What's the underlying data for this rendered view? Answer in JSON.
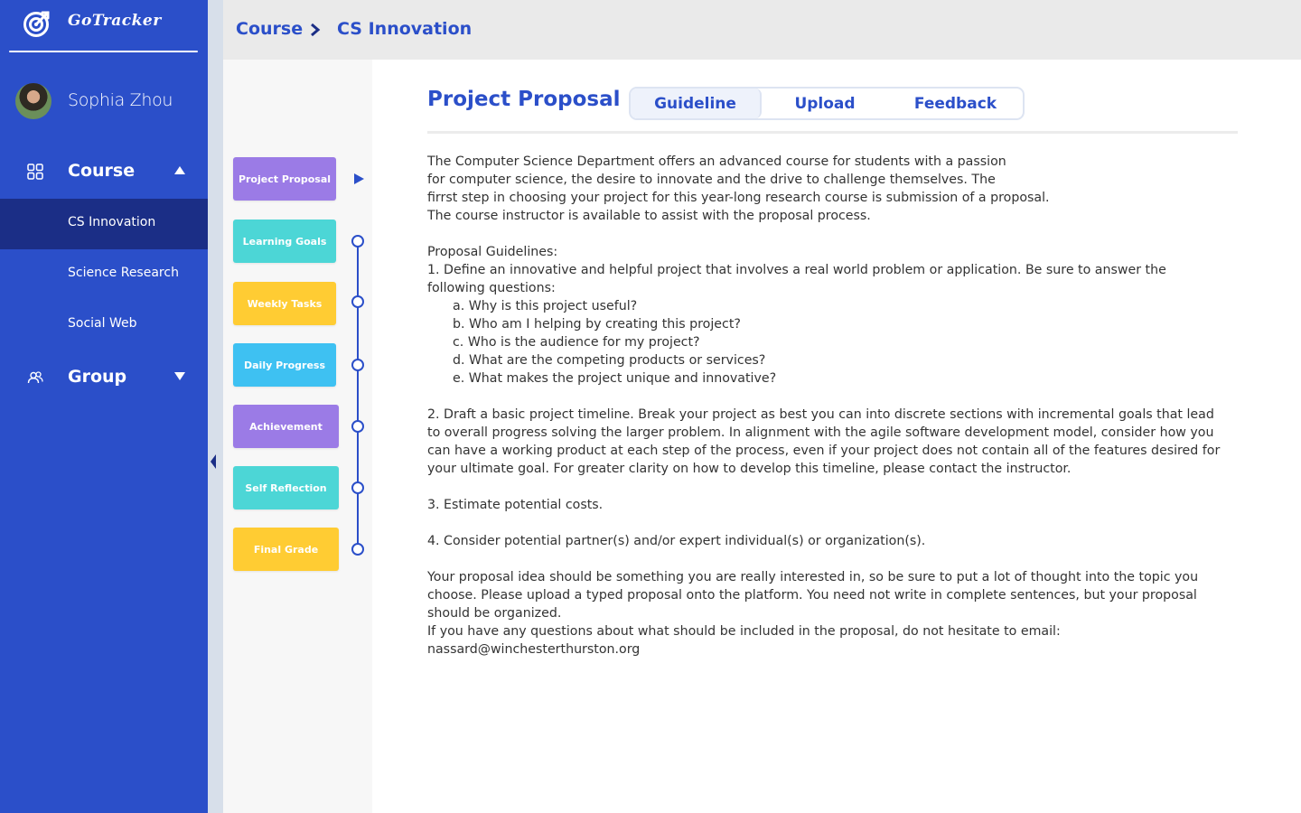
{
  "app": {
    "name": "GoTracker",
    "colors": {
      "sidebar": "#2b4fc9",
      "sidebar_active": "#1b2e86",
      "accent": "#2b4fc9",
      "header_bg": "#eaeaea",
      "purple": "#9b7be6",
      "teal": "#4cd6d6",
      "yellow": "#ffcc33",
      "sky": "#3ec1f2"
    }
  },
  "user": {
    "name": "Sophia Zhou"
  },
  "sidebar": {
    "course_label": "Course",
    "course_items": [
      "CS Innovation",
      "Science Research",
      "Social Web"
    ],
    "active_item": "CS Innovation",
    "group_label": "Group"
  },
  "breadcrumb": {
    "level1": "Course",
    "level2": "CS Innovation"
  },
  "steps": [
    {
      "label": "Project Proposal",
      "color": "#9b7be6"
    },
    {
      "label": "Learning Goals",
      "color": "#4cd6d6"
    },
    {
      "label": "Weekly Tasks",
      "color": "#ffcc33"
    },
    {
      "label": "Daily Progress",
      "color": "#3ec1f2"
    },
    {
      "label": "Achievement",
      "color": "#9b7be6"
    },
    {
      "label": "Self Reflection",
      "color": "#4cd6d6"
    },
    {
      "label": "Final Grade",
      "color": "#ffcc33"
    }
  ],
  "main": {
    "title": "Project Proposal",
    "tabs": [
      "Guideline",
      "Upload",
      "Feedback"
    ],
    "active_tab": "Guideline",
    "content": {
      "intro": [
        "The Computer Science Department offers an advanced course for students with a passion",
        "for computer science, the desire to innovate and the drive to challenge themselves. The",
        "firrst step in choosing your project for this year-long research course is submission of a proposal.",
        "The course instructor is available to assist with the proposal process."
      ],
      "guidelines_heading": "Proposal Guidelines:",
      "item1": [
        "1. Define an innovative and helpful project that involves a real world problem or application. Be sure to answer the",
        "following questions:"
      ],
      "item1_questions": [
        "a. Why is this project useful?",
        "b. Who am I helping by creating this project?",
        "c. Who is the audience for my project?",
        "d. What are the competing products or services?",
        "e. What makes the project unique and innovative?"
      ],
      "item2": [
        "2. Draft a basic project timeline. Break your project as best you can into discrete sections with incremental goals that lead",
        "to overall progress solving the larger problem. In alignment with the agile software development model, consider how you",
        "can have a working product at each step of the process, even if your project does not contain all of the features desired for",
        "your ultimate goal. For greater clarity on how to develop this timeline, please contact the instructor."
      ],
      "item3": "3. Estimate potential costs.",
      "item4": "4. Consider potential partner(s) and/or expert individual(s) or organization(s).",
      "closing": [
        "Your proposal idea should be something you are really interested in, so be sure to put a lot of thought into the topic you",
        "choose. Please upload a typed proposal onto the platform. You need not write in complete sentences, but your proposal",
        "should be organized.",
        "If you have any questions about what should be included in the proposal, do not hesitate to email:",
        "nassard@winchesterthurston.org"
      ]
    }
  }
}
